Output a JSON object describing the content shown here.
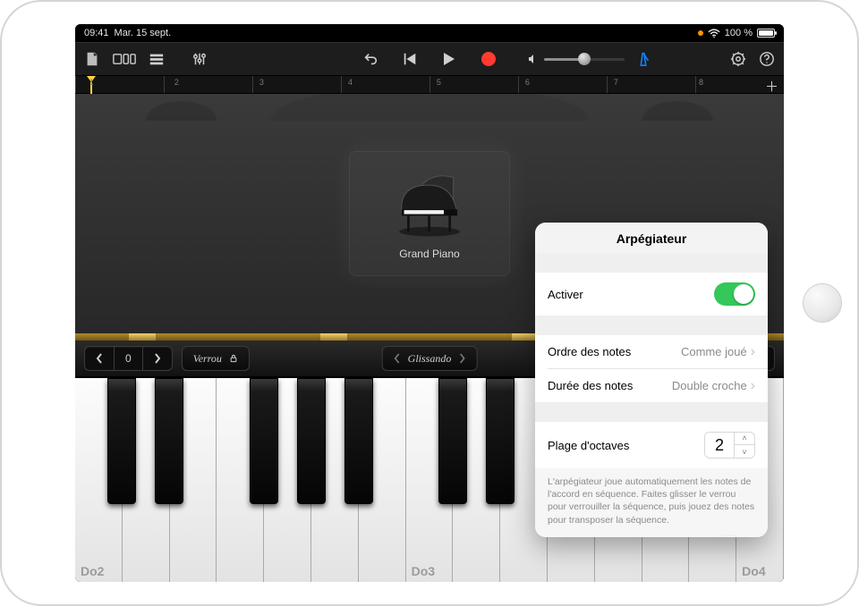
{
  "status": {
    "time": "09:41",
    "date": "Mar. 15 sept.",
    "battery_pct": "100 %"
  },
  "ruler": {
    "bars": [
      "1",
      "2",
      "3",
      "4",
      "5",
      "6",
      "7",
      "8"
    ]
  },
  "instrument": {
    "name": "Grand Piano"
  },
  "controls": {
    "octave_value": "0",
    "lock_label": "Verrou",
    "glissando_label": "Glissando"
  },
  "key_labels": {
    "c2": "Do2",
    "c3": "Do3",
    "c4": "Do4"
  },
  "popover": {
    "title": "Arpégiateur",
    "activate_label": "Activer",
    "note_order_label": "Ordre des notes",
    "note_order_value": "Comme joué",
    "note_rate_label": "Durée des notes",
    "note_rate_value": "Double croche",
    "octave_range_label": "Plage d'octaves",
    "octave_range_value": "2",
    "description": "L'arpégiateur joue automatiquement les notes de l'accord en séquence. Faites glisser le verrou pour verrouiller la séquence, puis jouez des notes pour transposer la séquence."
  }
}
